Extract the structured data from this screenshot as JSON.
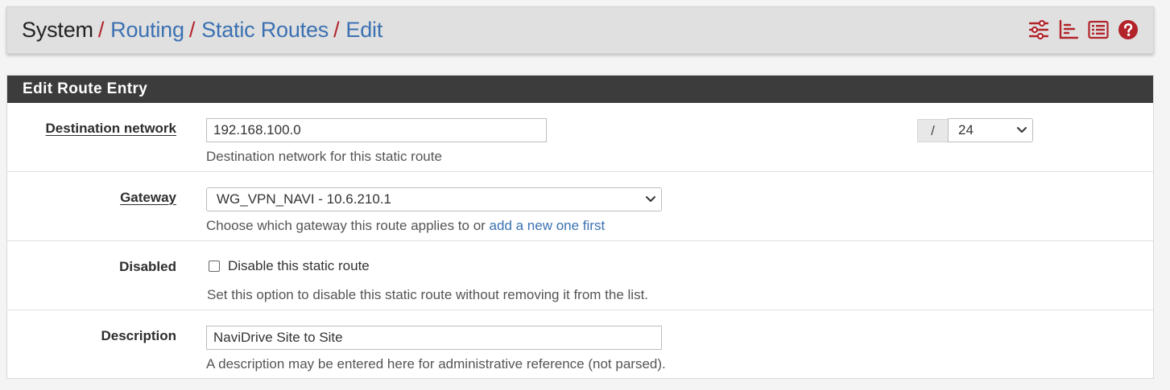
{
  "breadcrumb": {
    "root": "System",
    "items": [
      "Routing",
      "Static Routes",
      "Edit"
    ],
    "separator": "/"
  },
  "header_icons": [
    "sliders-icon",
    "bar-chart-icon",
    "list-icon",
    "help-icon"
  ],
  "colors": {
    "accent_red": "#b2232a",
    "link_blue": "#3b71b2",
    "panel_header": "#3c3c3c"
  },
  "panel": {
    "title": "Edit Route Entry"
  },
  "form": {
    "destination": {
      "label": "Destination network",
      "value": "192.168.100.0",
      "mask_separator": "/",
      "mask_value": "24",
      "help": "Destination network for this static route"
    },
    "gateway": {
      "label": "Gateway",
      "value": "WG_VPN_NAVI - 10.6.210.1",
      "help": "Choose which gateway this route applies to or ",
      "help_link": "add a new one first"
    },
    "disabled": {
      "label": "Disabled",
      "checkbox_label": "Disable this static route",
      "checked": false,
      "help": "Set this option to disable this static route without removing it from the list."
    },
    "description": {
      "label": "Description",
      "value": "NaviDrive Site to Site",
      "help": "A description may be entered here for administrative reference (not parsed)."
    }
  }
}
